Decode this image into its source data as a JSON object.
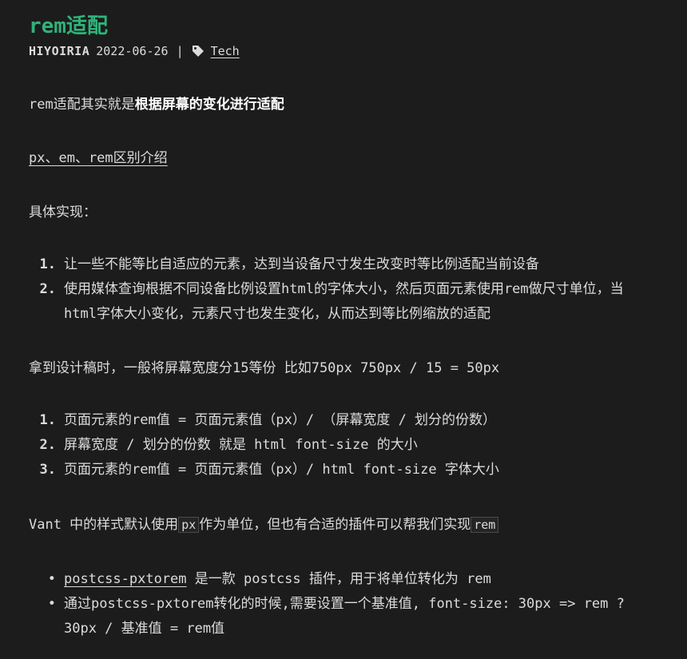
{
  "post": {
    "title": "rem适配",
    "author": "HIYOIRIA",
    "date": "2022-06-26",
    "separator": "|",
    "tag": "Tech",
    "tag_icon": "tag-icon"
  },
  "p1": {
    "prefix": "rem适配其实就是",
    "bold": "根据屏幕的变化进行适配"
  },
  "p2": {
    "link": "px、em、rem区别介绍"
  },
  "p3": {
    "text": "具体实现："
  },
  "list1": [
    {
      "num": "1.",
      "text": "让一些不能等比自适应的元素，达到当设备尺寸发生改变时等比例适配当前设备"
    },
    {
      "num": "2.",
      "text": "使用媒体查询根据不同设备比例设置html的字体大小，然后页面元素使用rem做尺寸单位，当",
      "cont": "html字体大小变化，元素尺寸也发生变化，从而达到等比例缩放的适配"
    }
  ],
  "p4": {
    "text": "拿到设计稿时，一般将屏幕宽度分15等份 比如750px 750px / 15 = 50px"
  },
  "list2": [
    {
      "num": "1.",
      "text": "页面元素的rem值 = 页面元素值（px）/ （屏幕宽度 / 划分的份数）"
    },
    {
      "num": "2.",
      "text": "屏幕宽度 / 划分的份数 就是 html font-size 的大小"
    },
    {
      "num": "3.",
      "text": "页面元素的rem值 = 页面元素值（px）/ html font-size 字体大小"
    }
  ],
  "p5": {
    "prefix": "Vant 中的样式默认使用",
    "code1": "px",
    "middle": "作为单位，但也有合适的插件可以帮我们实现",
    "code2": "rem"
  },
  "list3": [
    {
      "bullet": "•",
      "link": "postcss-pxtorem",
      "text": " 是一款 postcss 插件，用于将单位转化为 rem"
    },
    {
      "bullet": "•",
      "text": "通过postcss-pxtorem转化的时候,需要设置一个基准值, font-size: 30px => rem ?",
      "cont": "30px / 基准值 = rem值"
    }
  ]
}
